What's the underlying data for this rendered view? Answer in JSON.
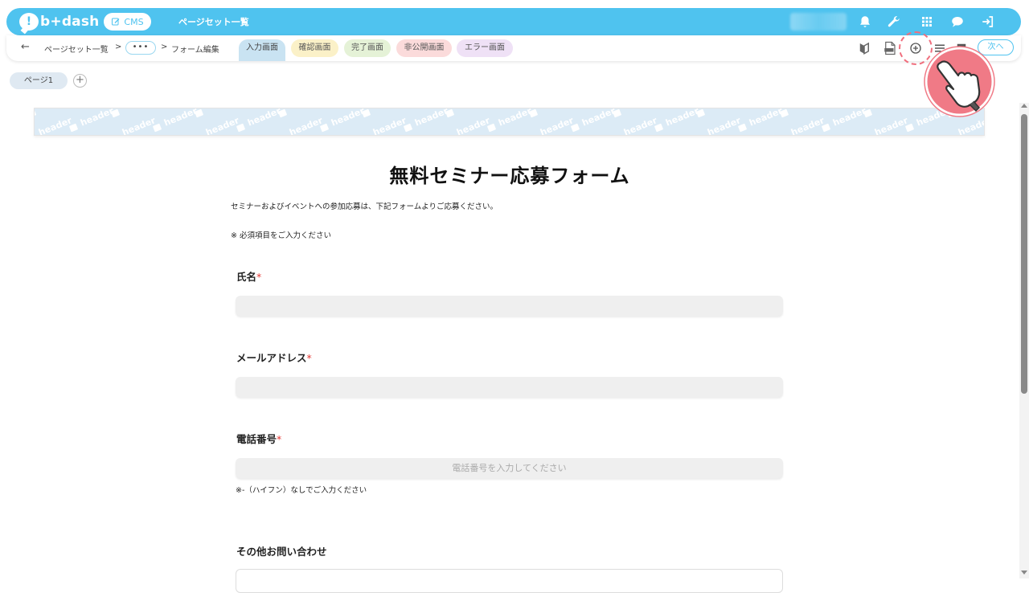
{
  "app": {
    "logo_text": "b+dash",
    "cms_label": "CMS",
    "top_title": "ページセット一覧",
    "colors": {
      "accent": "#4fc3ef",
      "required": "#e53935",
      "highlight": "#f06e7d"
    },
    "top_icons": [
      "bell-icon",
      "wrench-icon",
      "grid-icon",
      "chat-icon",
      "logout-icon"
    ]
  },
  "toolbar": {
    "back_icon": "←",
    "breadcrumb_1": "ページセット一覧",
    "separator": ">",
    "more_label": "•••",
    "breadcrumb_2": "フォーム編集",
    "tabs": [
      {
        "label": "入力画面",
        "active": true
      },
      {
        "label": "確認画面"
      },
      {
        "label": "完了画面"
      },
      {
        "label": "非公開画面"
      },
      {
        "label": "エラー画面"
      }
    ],
    "tool_icons": [
      "beginner-icon",
      "html-file-icon",
      "add-circle-icon",
      "list-icon",
      "square-icon"
    ],
    "next_label": "次へ"
  },
  "pages": {
    "page1_label": "ページ1",
    "add_label": "+"
  },
  "header_strip": {
    "watermark": "header"
  },
  "form": {
    "title": "無料セミナー応募フォーム",
    "description": "セミナーおよびイベントへの参加応募は、下記フォームよりご応募ください。",
    "note": "※ 必須項目をご入力ください",
    "fields": [
      {
        "label": "氏名",
        "required": "*",
        "placeholder": ""
      },
      {
        "label": "メールアドレス",
        "required": "*",
        "placeholder": ""
      },
      {
        "label": "電話番号",
        "required": "*",
        "placeholder": "電話番号を入力してください",
        "help": "※-（ハイフン）なしでご入力ください"
      },
      {
        "label": "その他お問い合わせ"
      }
    ]
  }
}
